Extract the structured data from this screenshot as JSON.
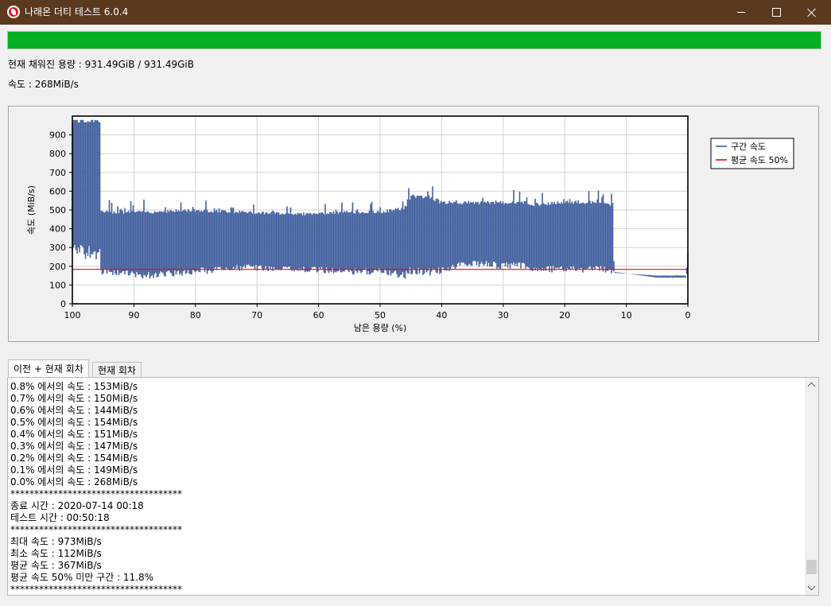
{
  "window": {
    "title": "나래온 더티 테스트 6.0.4",
    "icon": "naraeon-logo-icon"
  },
  "progress": {
    "fraction": 1.0,
    "color": "#06b025"
  },
  "status": {
    "capacity_line": "현재 채워진 용량 : 931.49GiB / 931.49GiB",
    "speed_line": "속도 : 268MiB/s"
  },
  "chart_data": {
    "type": "area",
    "title": "",
    "xlabel": "남은 용량 (%)",
    "ylabel": "속도 (MiB/s)",
    "xlim": [
      100,
      0
    ],
    "ylim": [
      0,
      1000
    ],
    "x_ticks": [
      100,
      90,
      80,
      70,
      60,
      50,
      40,
      30,
      20,
      10,
      0
    ],
    "y_ticks": [
      0,
      100,
      200,
      300,
      400,
      500,
      600,
      700,
      800,
      900
    ],
    "grid": true,
    "legend_position": "top-right",
    "series": [
      {
        "name": "구간 속도",
        "color": "#4563a0",
        "kind": "band",
        "x": [
          100,
          95.5,
          95.4,
          88,
          80,
          72,
          62,
          55,
          50,
          46,
          45,
          42,
          40,
          36,
          33,
          30,
          26,
          25,
          20,
          15,
          12.1,
          12,
          5,
          0.3,
          0
        ],
        "low": [
          320,
          310,
          190,
          170,
          190,
          210,
          200,
          190,
          190,
          170,
          200,
          190,
          200,
          230,
          230,
          220,
          225,
          200,
          205,
          205,
          200,
          170,
          140,
          140,
          200
        ],
        "high": [
          960,
          960,
          480,
          480,
          490,
          480,
          470,
          480,
          480,
          500,
          560,
          560,
          530,
          530,
          530,
          530,
          530,
          520,
          530,
          530,
          520,
          165,
          150,
          150,
          270
        ]
      },
      {
        "name": "평균 속도 50%",
        "color": "#ff0000",
        "kind": "line",
        "x": [
          100,
          0
        ],
        "y": [
          183.5,
          183.5
        ]
      }
    ]
  },
  "tabs": [
    {
      "label": "이전 + 현재 회차",
      "active": true
    },
    {
      "label": "현재 회차",
      "active": false
    }
  ],
  "log_lines": [
    "0.8% 에서의 속도 : 153MiB/s",
    "0.7% 에서의 속도 : 150MiB/s",
    "0.6% 에서의 속도 : 144MiB/s",
    "0.5% 에서의 속도 : 154MiB/s",
    "0.4% 에서의 속도 : 151MiB/s",
    "0.3% 에서의 속도 : 147MiB/s",
    "0.2% 에서의 속도 : 154MiB/s",
    "0.1% 에서의 속도 : 149MiB/s",
    "0.0% 에서의 속도 : 268MiB/s",
    "************************************",
    "종료 시간 : 2020-07-14 00:18",
    "테스트 시간 : 00:50:18",
    "************************************",
    "최대 속도 : 973MiB/s",
    "최소 속도 : 112MiB/s",
    "평균 속도 : 367MiB/s",
    "평균 속도 50% 미만 구간 : 11.8%",
    "************************************"
  ],
  "scroll": {
    "fraction": 0.96
  }
}
